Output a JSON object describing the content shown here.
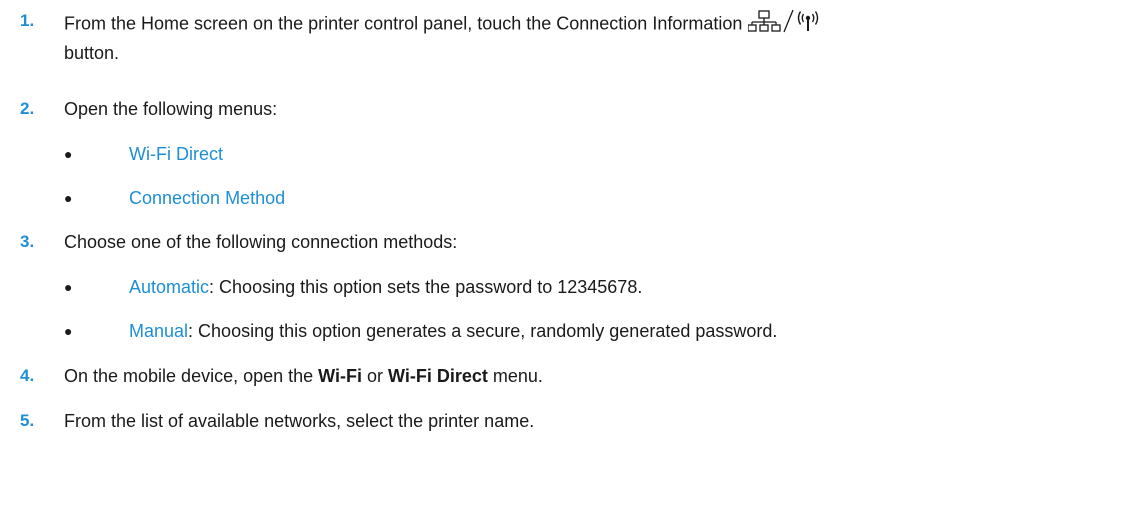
{
  "steps": [
    {
      "number": "1.",
      "text": "From the Home screen on the printer control panel, touch the Connection Information",
      "continuation": "button.",
      "icon": "network-wireless-icon"
    },
    {
      "number": "2.",
      "text": "Open the following menus:",
      "bullets": [
        {
          "link": "Wi-Fi Direct"
        },
        {
          "link": "Connection Method"
        }
      ]
    },
    {
      "number": "3.",
      "text": "Choose one of the following connection methods:",
      "bullets": [
        {
          "link": "Automatic",
          "rest": ": Choosing this option sets the password to 12345678."
        },
        {
          "link": "Manual",
          "rest": ": Choosing this option generates a secure, randomly generated password."
        }
      ]
    },
    {
      "number": "4.",
      "text_pre": "On the mobile device, open the ",
      "bold_1": "Wi-Fi",
      "text_mid": " or ",
      "bold_2": "Wi-Fi Direct",
      "text_post": " menu."
    },
    {
      "number": "5.",
      "text": "From the list of available networks, select the printer name."
    }
  ],
  "colors": {
    "accent": "#1e8fd6",
    "text": "#1a1a1a"
  }
}
